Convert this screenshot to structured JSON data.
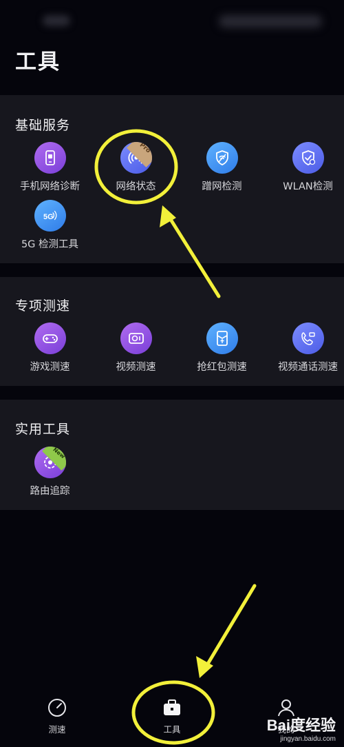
{
  "page": {
    "title": "工具"
  },
  "sections": [
    {
      "title": "基础服务",
      "items": [
        {
          "label": "手机网络诊断",
          "icon": "phone-diagnose-icon",
          "color": "#9b59e8"
        },
        {
          "label": "网络状态",
          "icon": "network-status-icon",
          "color": "#6a5ae6",
          "badge": "Pro"
        },
        {
          "label": "蹭网检测",
          "icon": "wifi-theft-shield-icon",
          "color": "#3d8ff0"
        },
        {
          "label": "WLAN检测",
          "icon": "wlan-check-shield-icon",
          "color": "#5a6cf0"
        },
        {
          "label": "5G 检测工具",
          "icon": "5g-icon",
          "color": "#3d8ff0",
          "icon_text": "5G"
        }
      ]
    },
    {
      "title": "专项测速",
      "items": [
        {
          "label": "游戏测速",
          "icon": "gamepad-icon",
          "color": "#9b59e8"
        },
        {
          "label": "视频测速",
          "icon": "video-icon",
          "color": "#9b59e8"
        },
        {
          "label": "抢红包测速",
          "icon": "red-envelope-icon",
          "color": "#3d8ff0"
        },
        {
          "label": "视频通话测速",
          "icon": "video-call-icon",
          "color": "#5a6cf0"
        }
      ]
    },
    {
      "title": "实用工具",
      "items": [
        {
          "label": "路由追踪",
          "icon": "route-trace-icon",
          "color": "#9b59e8",
          "badge": "New"
        }
      ]
    }
  ],
  "bottom_nav": [
    {
      "label": "测速",
      "icon": "speedometer-icon"
    },
    {
      "label": "工具",
      "icon": "toolbox-icon",
      "active": true
    },
    {
      "label": "我的",
      "icon": "user-icon"
    }
  ],
  "watermark": {
    "brand": "Bai度经验",
    "url": "jingyan.baidu.com"
  },
  "annotation_color": "#f2f03a"
}
